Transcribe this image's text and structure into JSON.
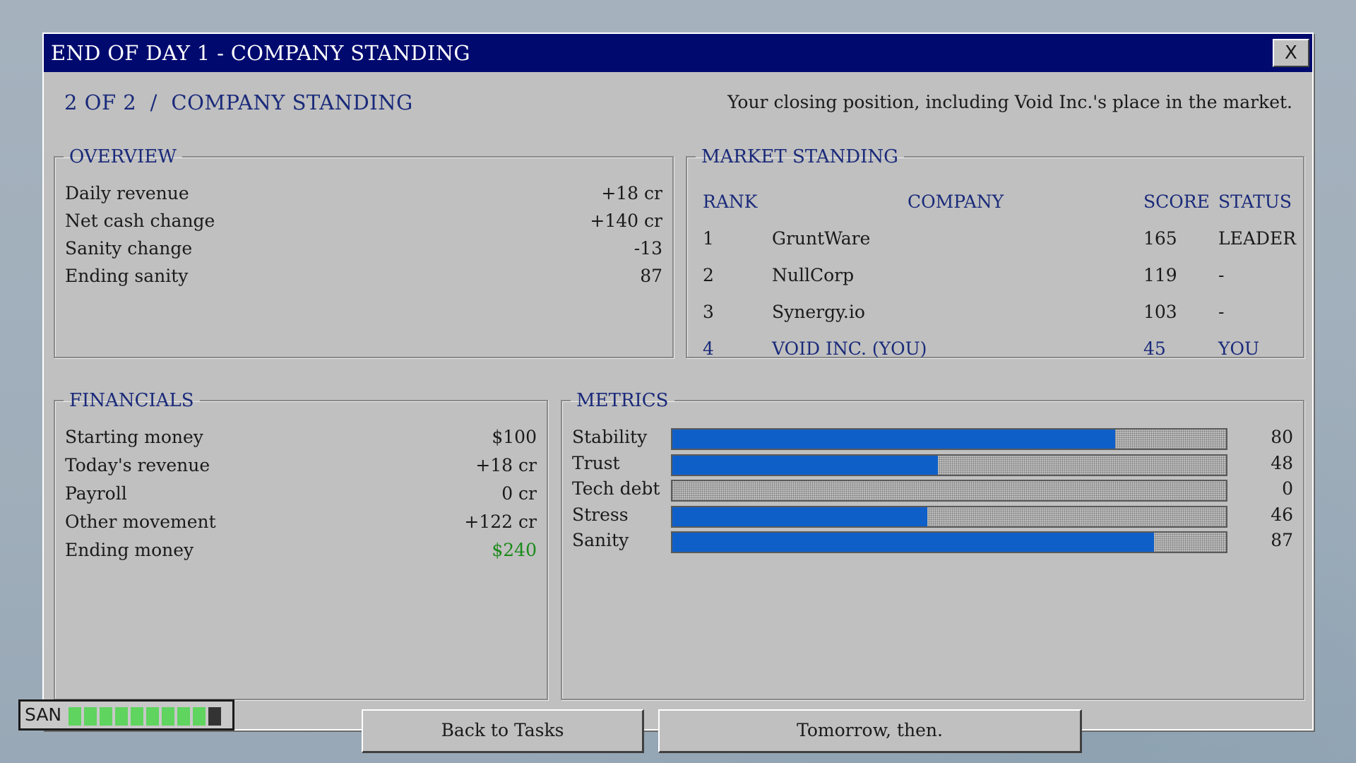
{
  "window": {
    "title": "END OF DAY 1 - COMPANY STANDING",
    "close_label": "X"
  },
  "header": {
    "breadcrumb": "2 OF 2  /  COMPANY STANDING",
    "subtitle": "Your closing position, including Void Inc.'s place in the market."
  },
  "overview": {
    "legend": "OVERVIEW",
    "rows": [
      {
        "label": "Daily revenue",
        "value": "+18 cr"
      },
      {
        "label": "Net cash change",
        "value": "+140 cr"
      },
      {
        "label": "Sanity change",
        "value": "-13"
      },
      {
        "label": "Ending sanity",
        "value": "87"
      }
    ]
  },
  "market": {
    "legend": "MARKET STANDING",
    "columns": {
      "rank": "RANK",
      "company": "COMPANY",
      "score": "SCORE",
      "status": "STATUS"
    },
    "rows": [
      {
        "rank": "1",
        "company": "GruntWare",
        "score": "165",
        "status": "LEADER"
      },
      {
        "rank": "2",
        "company": "NullCorp",
        "score": "119",
        "status": "-"
      },
      {
        "rank": "3",
        "company": "Synergy.io",
        "score": "103",
        "status": "-"
      },
      {
        "rank": "4",
        "company": "VOID INC. (YOU)",
        "score": "45",
        "status": "YOU"
      }
    ],
    "highlight_color": "#1a2a7a"
  },
  "financials": {
    "legend": "FINANCIALS",
    "rows": [
      {
        "label": "Starting money",
        "value": "$100"
      },
      {
        "label": "Today's revenue",
        "value": "+18 cr"
      },
      {
        "label": "Payroll",
        "value": "0 cr"
      },
      {
        "label": "Other movement",
        "value": "+122 cr"
      },
      {
        "label": "Ending money",
        "value": "$240"
      }
    ],
    "positive_color": "#1a8a1a"
  },
  "metrics": {
    "legend": "METRICS",
    "max": 100,
    "bar_color": "#0f5fc8",
    "items": [
      {
        "label": "Stability",
        "value": 80
      },
      {
        "label": "Trust",
        "value": 48
      },
      {
        "label": "Tech debt",
        "value": 0
      },
      {
        "label": "Stress",
        "value": 46
      },
      {
        "label": "Sanity",
        "value": 87
      }
    ]
  },
  "buttons": {
    "back": "Back to Tasks",
    "tomorrow": "Tomorrow, then."
  },
  "sanity_meter": {
    "label": "SAN",
    "segments_total": 10,
    "segments_filled": 9,
    "on_color": "#5fd45f",
    "off_color": "#333333"
  }
}
